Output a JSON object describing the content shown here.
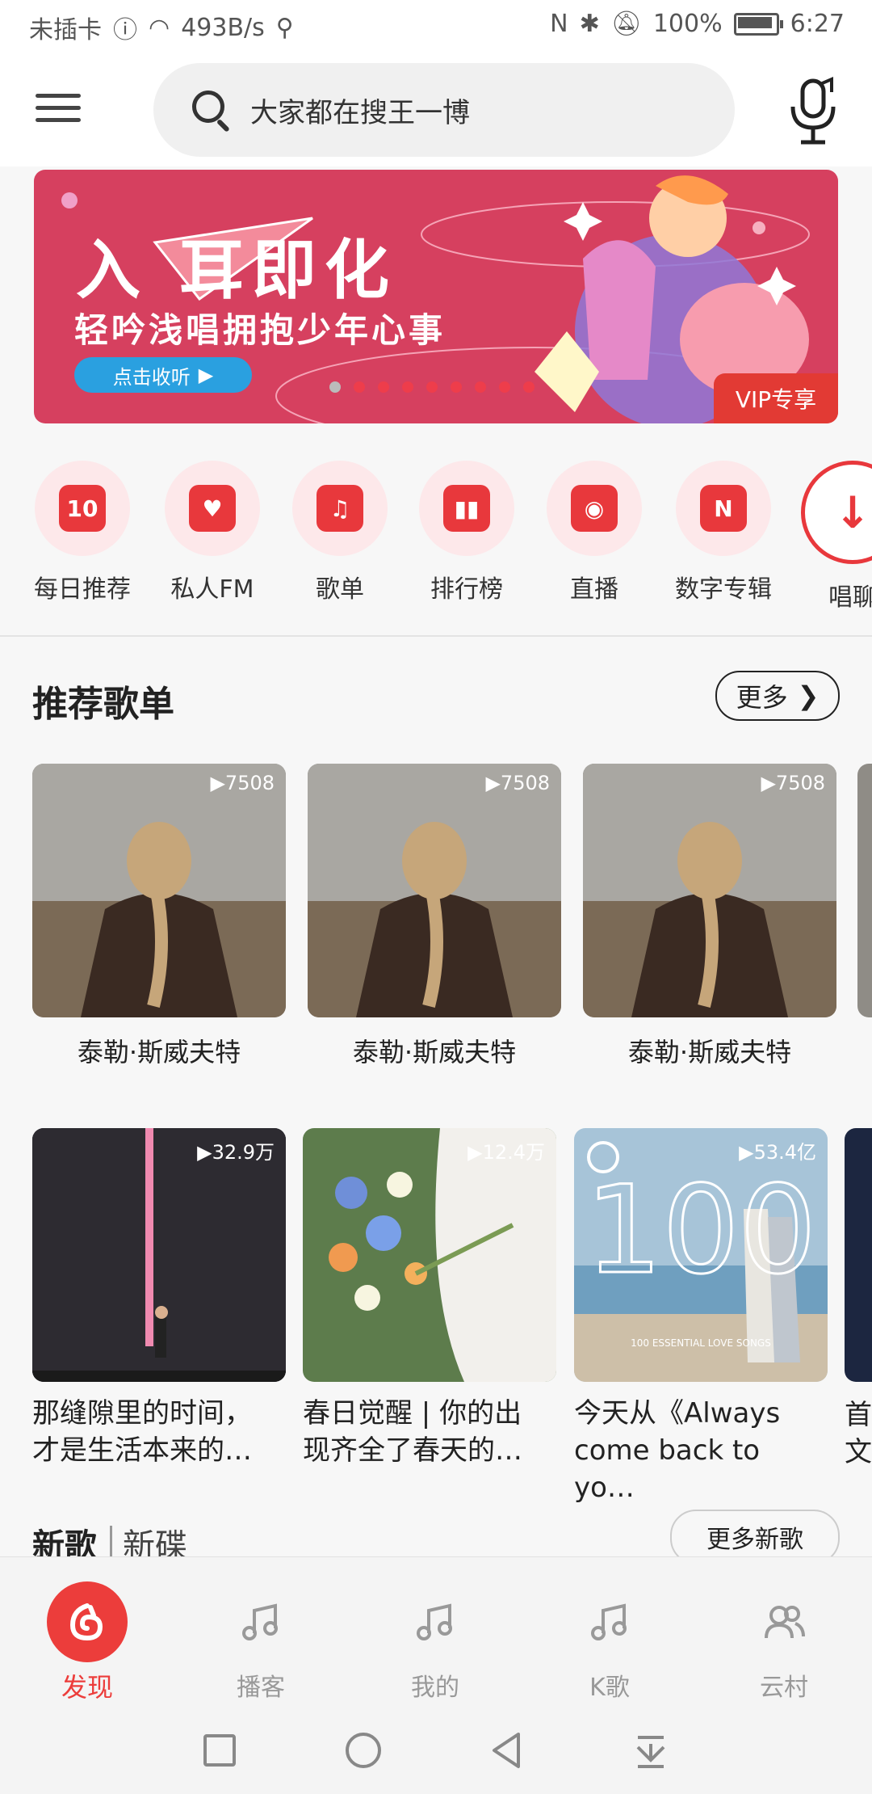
{
  "status_bar": {
    "carrier": "未插卡",
    "speed": "493B/s",
    "battery": "100%",
    "time": "6:27"
  },
  "header": {
    "search_placeholder": "大家都在搜王一博",
    "menu_icon": "hamburger-icon",
    "mic_icon": "microphone-icon"
  },
  "banner": {
    "title": "入 耳即化",
    "subtitle": "轻吟浅唱拥抱少年心事",
    "cta": "点击收听",
    "badge": "VIP专享",
    "page_count": 9,
    "current_page": 1
  },
  "quick_entries": [
    {
      "label": "每日推荐",
      "icon": "calendar-icon",
      "glyph": "10"
    },
    {
      "label": "私人FM",
      "icon": "radio-icon",
      "glyph": "♥"
    },
    {
      "label": "歌单",
      "icon": "playlist-icon",
      "glyph": "♫"
    },
    {
      "label": "排行榜",
      "icon": "chart-icon",
      "glyph": "▮▮"
    },
    {
      "label": "直播",
      "icon": "live-icon",
      "glyph": "◉"
    },
    {
      "label": "数字专辑",
      "icon": "album-icon",
      "glyph": "N"
    },
    {
      "label": "唱聊",
      "icon": "download-icon",
      "glyph": "↓"
    }
  ],
  "recommended": {
    "title": "推荐歌单",
    "more": "更多",
    "row1": [
      {
        "name": "泰勒·斯威夫特",
        "plays": "7508"
      },
      {
        "name": "泰勒·斯威夫特",
        "plays": "7508"
      },
      {
        "name": "泰勒·斯威夫特",
        "plays": "7508"
      }
    ],
    "row2": [
      {
        "line1": "那缝隙里的时间，",
        "line2": "才是生活本来的…",
        "plays": "32.9万"
      },
      {
        "line1": "春日觉醒 | 你的出",
        "line2": "现齐全了春天的…",
        "plays": "12.4万"
      },
      {
        "line1": "今天从《Always",
        "line2": "come back to yo…",
        "plays": "53.4亿",
        "cover_text": "100",
        "cover_sub": "100 ESSENTIAL LOVE SONGS"
      },
      {
        "line1": "首",
        "line2": "文"
      }
    ]
  },
  "new_songs": {
    "title": "新歌",
    "subtitle": "新碟",
    "more": "更多新歌"
  },
  "tabs": [
    {
      "label": "发现",
      "icon": "netease-logo-icon",
      "active": true
    },
    {
      "label": "播客",
      "icon": "music-note-icon"
    },
    {
      "label": "我的",
      "icon": "music-note-icon"
    },
    {
      "label": "K歌",
      "icon": "music-note-icon"
    },
    {
      "label": "云村",
      "icon": "users-icon"
    }
  ],
  "colors": {
    "accent": "#ec3d3b",
    "banner_bg": "#d6405f",
    "cta_blue": "#2aa0e0"
  }
}
